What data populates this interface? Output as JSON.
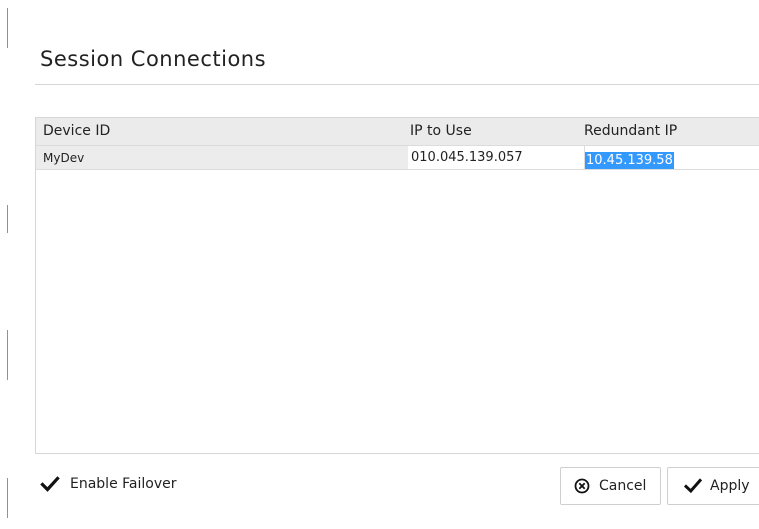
{
  "dialog": {
    "title": "Session Connections"
  },
  "grid": {
    "columns": [
      "Device ID",
      "IP to Use",
      "Redundant IP"
    ],
    "rows": [
      {
        "device_id": "MyDev",
        "ip_to_use": "010.045.139.057",
        "redundant_ip": "10.45.139.58"
      }
    ]
  },
  "failover": {
    "label": "Enable Failover",
    "checked": true
  },
  "buttons": {
    "cancel_label": "Cancel",
    "apply_label": "Apply"
  },
  "colors": {
    "selection": "#3399ff",
    "header_bg": "#ebebeb"
  },
  "icons": {
    "failover_checkbox": "checkmark-icon",
    "cancel": "circle-x-icon",
    "apply": "checkmark-icon"
  }
}
